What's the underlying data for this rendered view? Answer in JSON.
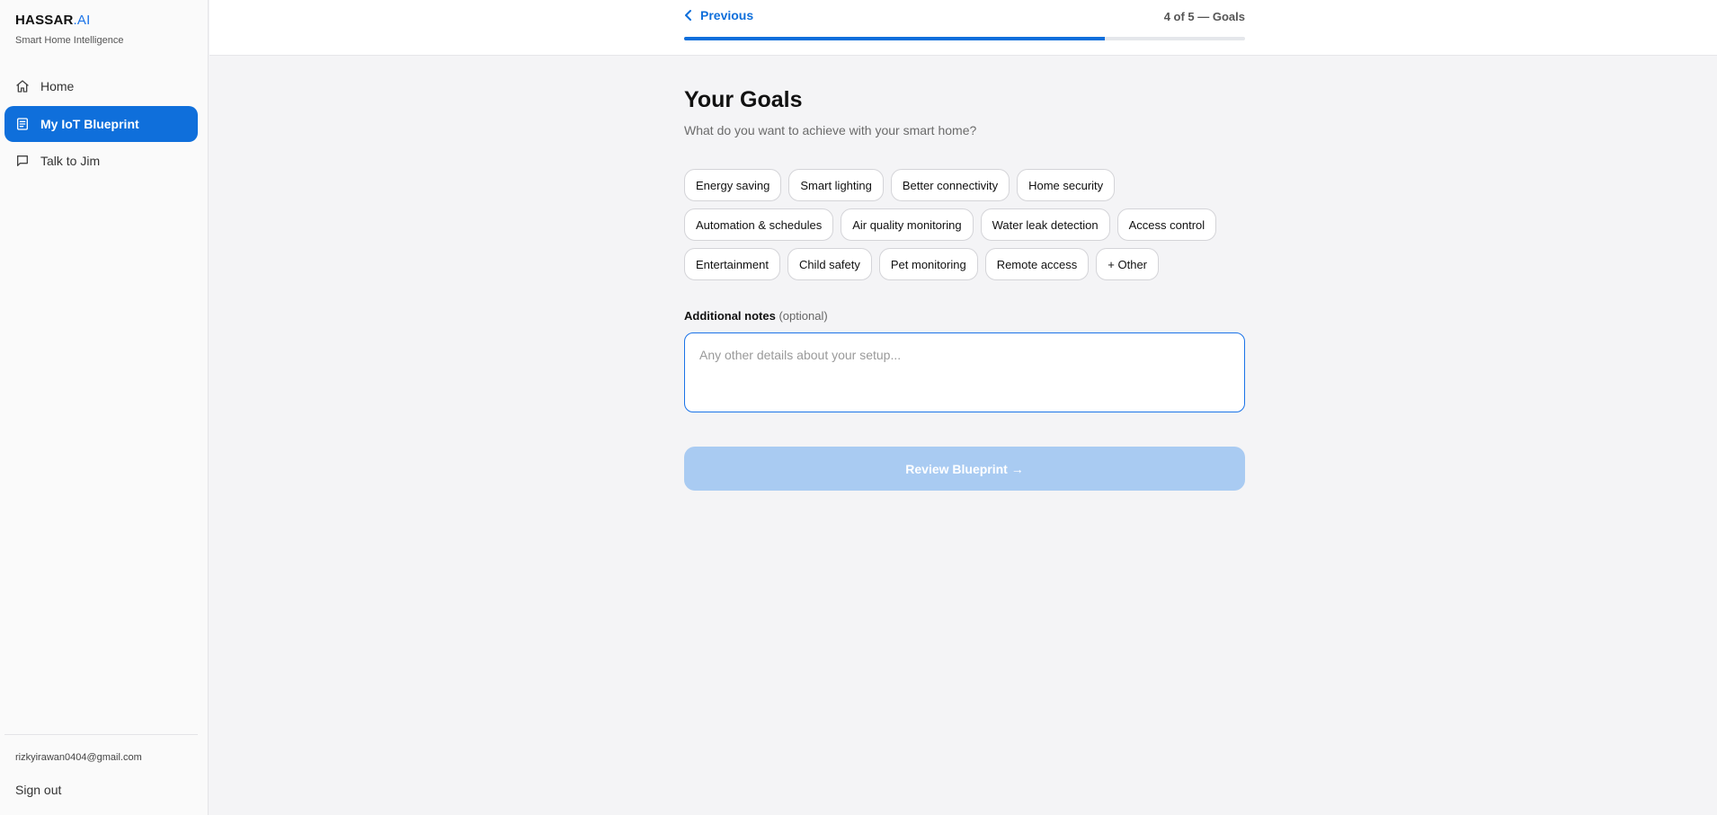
{
  "brand": {
    "name": "HASSAR",
    "suffix": ".AI",
    "tagline": "Smart Home Intelligence"
  },
  "sidebar": {
    "items": [
      {
        "label": "Home",
        "icon": "home-icon"
      },
      {
        "label": "My IoT Blueprint",
        "icon": "document-icon",
        "active": true
      },
      {
        "label": "Talk to Jim",
        "icon": "chat-icon"
      }
    ],
    "user_email": "rizkyirawan0404@gmail.com",
    "sign_out": "Sign out"
  },
  "header": {
    "previous_label": "Previous",
    "step_label": "4 of 5 — Goals",
    "progress": 0.75
  },
  "main": {
    "title": "Your Goals",
    "subtitle": "What do you want to achieve with your smart home?",
    "goal_rows": [
      [
        "Energy saving",
        "Smart lighting",
        "Better connectivity",
        "Home security"
      ],
      [
        "Automation & schedules",
        "Air quality monitoring",
        "Water leak detection",
        "Access control"
      ],
      [
        "Entertainment",
        "Child safety",
        "Pet monitoring",
        "Remote access",
        "+ Other"
      ]
    ],
    "notes_label": "Additional notes",
    "notes_optional": "(optional)",
    "notes_placeholder": "Any other details about your setup...",
    "notes_value": "",
    "review_button": "Review Blueprint →"
  },
  "colors": {
    "accent": "#0f6fdb",
    "disabled_button": "#a9cbf2"
  }
}
